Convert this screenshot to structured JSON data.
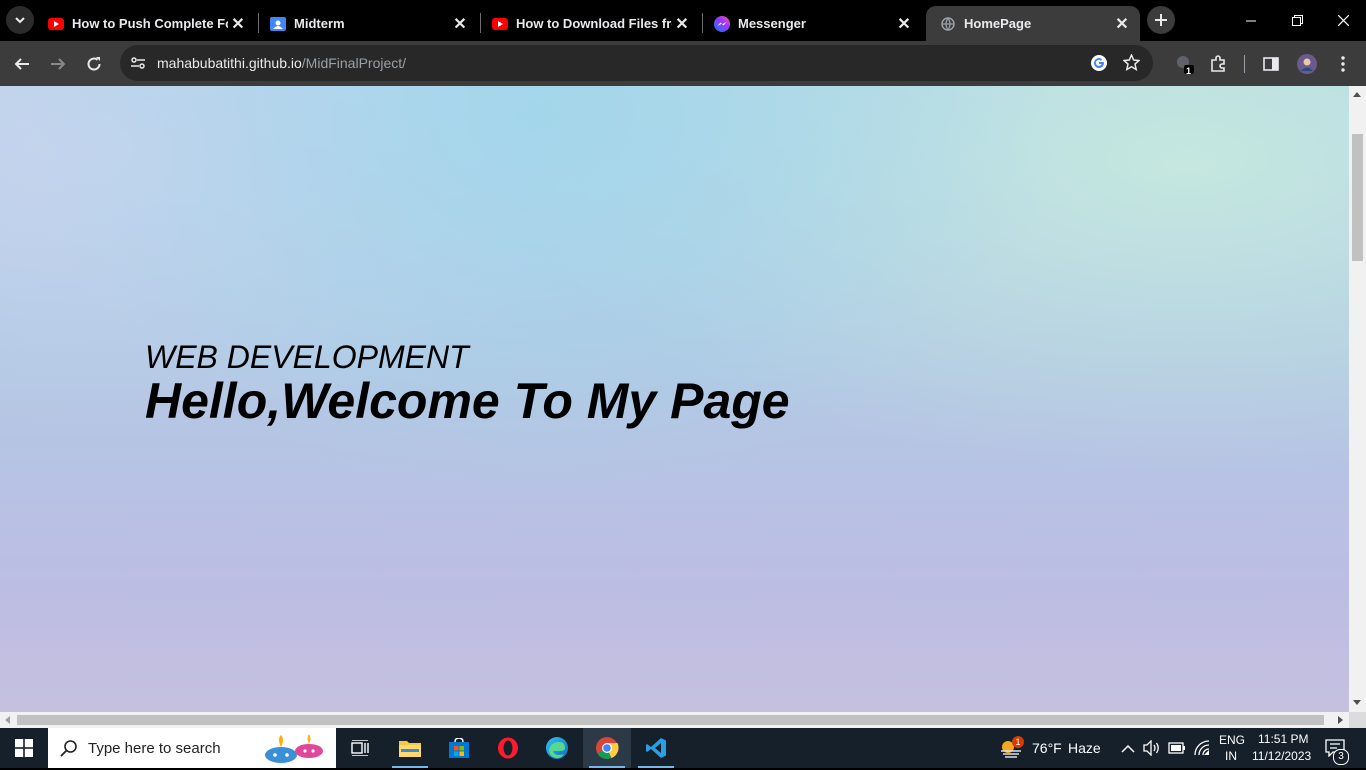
{
  "browser": {
    "tabs": [
      {
        "title": "How to Push Complete Folder",
        "favicon": "youtube-icon",
        "active": false
      },
      {
        "title": "Midterm",
        "favicon": "classroom-icon",
        "active": false
      },
      {
        "title": "How to Download Files from",
        "favicon": "youtube-icon",
        "active": false
      },
      {
        "title": "Messenger",
        "favicon": "messenger-icon",
        "active": false
      },
      {
        "title": "HomePage",
        "favicon": "globe-icon",
        "active": true
      }
    ],
    "url_host": "mahabubatithi.github.io",
    "url_path": "/MidFinalProject/",
    "extension_badge": "1"
  },
  "page": {
    "subtitle": "WEB DEVELOPMENT",
    "title": "Hello,Welcome To My Page"
  },
  "taskbar": {
    "search_placeholder": "Type here to search",
    "weather_temp": "76°F",
    "weather_desc": "Haze",
    "weather_badge": "1",
    "language": "ENG",
    "region": "IN",
    "time": "11:51 PM",
    "date": "11/12/2023",
    "notifications": "3"
  },
  "colors": {
    "tab_strip": "#000000",
    "toolbar": "#3c3c3c",
    "taskbar": "#15202b"
  }
}
